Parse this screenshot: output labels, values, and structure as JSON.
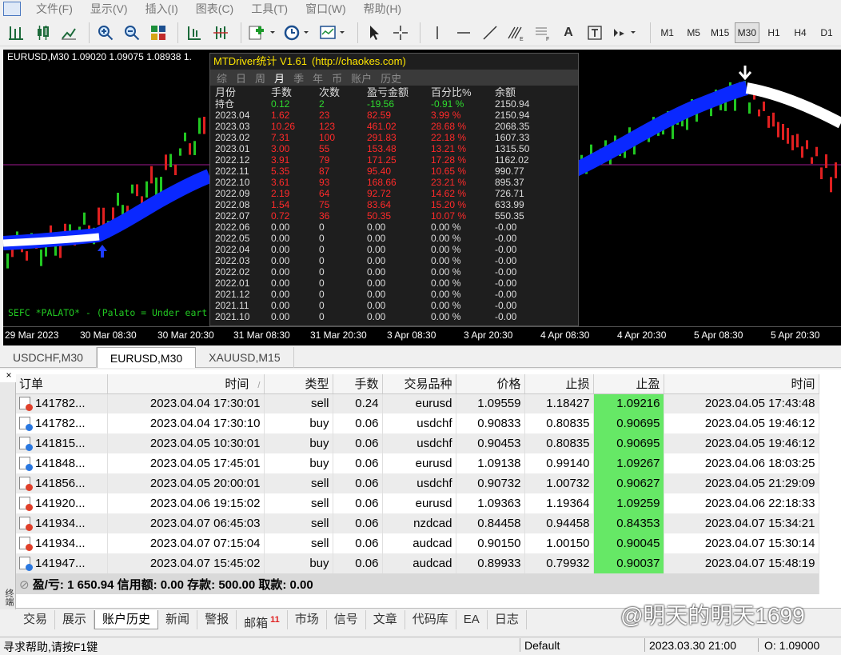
{
  "menu": [
    "文件(F)",
    "显示(V)",
    "插入(I)",
    "图表(C)",
    "工具(T)",
    "窗口(W)",
    "帮助(H)"
  ],
  "toolbar": {
    "icons": [
      "bar-chart-icon",
      "candle-chart-icon",
      "line-chart-icon",
      "zoom-in-icon",
      "zoom-out-icon",
      "tile-windows-icon",
      "chart-shift-icon",
      "autoscroll-icon",
      "indicators-icon",
      "periods-icon",
      "templates-icon",
      "cursor-icon",
      "crosshair-icon",
      "vertical-line-icon",
      "horizontal-line-icon",
      "trend-line-icon",
      "fibonacci-icon",
      "text-icon",
      "text-label-icon",
      "arrows-icon"
    ],
    "text_icon": "A",
    "timeframes": [
      "M1",
      "M5",
      "M15",
      "M30",
      "H1",
      "H4",
      "D1"
    ],
    "active_timeframe": "M30"
  },
  "chart": {
    "symbol_line": "EURUSD,M30  1.09020 1.09075 1.08938 1.",
    "indicator_label": "SEFC *PALATO* - (Palato = Under eart",
    "time_labels": [
      "29 Mar 2023",
      "30 Mar 08:30",
      "30 Mar 20:30",
      "31 Mar 08:30",
      "31 Mar 20:30",
      "3 Apr 08:30",
      "3 Apr 20:30",
      "4 Apr 08:30",
      "4 Apr 20:30",
      "5 Apr 08:30",
      "5 Apr 20:30"
    ],
    "colors": {
      "background": "#000000",
      "ma_line": "#0a28ff",
      "ma_highlight": "#ffffff",
      "bull": "#22c822",
      "bear": "#e02020"
    }
  },
  "panel": {
    "title": "MTDriver统计 V1.61",
    "url": "(http://chaokes.com)",
    "tabs": [
      "综",
      "日",
      "周",
      "月",
      "季",
      "年",
      "币",
      "账户",
      "历史"
    ],
    "active_tab": "月",
    "headers": [
      "月份",
      "手数",
      "次数",
      "盈亏金额",
      "百分比%",
      "余额"
    ],
    "rows": [
      {
        "c": [
          "持仓",
          "0.12",
          "2",
          "-19.56",
          "-0.91 %",
          "2150.94"
        ],
        "color": "green"
      },
      {
        "c": [
          "2023.04",
          "1.62",
          "23",
          "82.59",
          "3.99 %",
          "2150.94"
        ],
        "color": "red"
      },
      {
        "c": [
          "2023.03",
          "10.26",
          "123",
          "461.02",
          "28.68 %",
          "2068.35"
        ],
        "color": "red"
      },
      {
        "c": [
          "2023.02",
          "7.31",
          "100",
          "291.83",
          "22.18 %",
          "1607.33"
        ],
        "color": "red"
      },
      {
        "c": [
          "2023.01",
          "3.00",
          "55",
          "153.48",
          "13.21 %",
          "1315.50"
        ],
        "color": "red"
      },
      {
        "c": [
          "2022.12",
          "3.91",
          "79",
          "171.25",
          "17.28 %",
          "1162.02"
        ],
        "color": "red"
      },
      {
        "c": [
          "2022.11",
          "5.35",
          "87",
          "95.40",
          "10.65 %",
          "990.77"
        ],
        "color": "red"
      },
      {
        "c": [
          "2022.10",
          "3.61",
          "93",
          "168.66",
          "23.21 %",
          "895.37"
        ],
        "color": "red"
      },
      {
        "c": [
          "2022.09",
          "2.19",
          "64",
          "92.72",
          "14.62 %",
          "726.71"
        ],
        "color": "red"
      },
      {
        "c": [
          "2022.08",
          "1.54",
          "75",
          "83.64",
          "15.20 %",
          "633.99"
        ],
        "color": "red"
      },
      {
        "c": [
          "2022.07",
          "0.72",
          "36",
          "50.35",
          "10.07 %",
          "550.35"
        ],
        "color": "red"
      },
      {
        "c": [
          "2022.06",
          "0.00",
          "0",
          "0.00",
          "0.00 %",
          "-0.00"
        ],
        "color": "white"
      },
      {
        "c": [
          "2022.05",
          "0.00",
          "0",
          "0.00",
          "0.00 %",
          "-0.00"
        ],
        "color": "white"
      },
      {
        "c": [
          "2022.04",
          "0.00",
          "0",
          "0.00",
          "0.00 %",
          "-0.00"
        ],
        "color": "white"
      },
      {
        "c": [
          "2022.03",
          "0.00",
          "0",
          "0.00",
          "0.00 %",
          "-0.00"
        ],
        "color": "white"
      },
      {
        "c": [
          "2022.02",
          "0.00",
          "0",
          "0.00",
          "0.00 %",
          "-0.00"
        ],
        "color": "white"
      },
      {
        "c": [
          "2022.01",
          "0.00",
          "0",
          "0.00",
          "0.00 %",
          "-0.00"
        ],
        "color": "white"
      },
      {
        "c": [
          "2021.12",
          "0.00",
          "0",
          "0.00",
          "0.00 %",
          "-0.00"
        ],
        "color": "white"
      },
      {
        "c": [
          "2021.11",
          "0.00",
          "0",
          "0.00",
          "0.00 %",
          "-0.00"
        ],
        "color": "white"
      },
      {
        "c": [
          "2021.10",
          "0.00",
          "0",
          "0.00",
          "0.00 %",
          "-0.00"
        ],
        "color": "white"
      }
    ]
  },
  "chart_tabs": [
    "USDCHF,M30",
    "EURUSD,M30",
    "XAUUSD,M15"
  ],
  "active_chart_tab": "EURUSD,M30",
  "terminal": {
    "close": "×",
    "side_label": "终端",
    "columns": [
      "订单",
      "时间",
      "类型",
      "手数",
      "交易品种",
      "价格",
      "止损",
      "止盈",
      "时间"
    ],
    "sort_mark": "/",
    "rows": [
      {
        "order": "141782...",
        "open_time": "2023.04.04 17:30:01",
        "type": "sell",
        "lots": "0.24",
        "symbol": "eurusd",
        "price": "1.09559",
        "sl": "1.18427",
        "tp": "1.09216",
        "close_time": "2023.04.05 17:43:48"
      },
      {
        "order": "141782...",
        "open_time": "2023.04.04 17:30:10",
        "type": "buy",
        "lots": "0.06",
        "symbol": "usdchf",
        "price": "0.90833",
        "sl": "0.80835",
        "tp": "0.90695",
        "close_time": "2023.04.05 19:46:12"
      },
      {
        "order": "141815...",
        "open_time": "2023.04.05 10:30:01",
        "type": "buy",
        "lots": "0.06",
        "symbol": "usdchf",
        "price": "0.90453",
        "sl": "0.80835",
        "tp": "0.90695",
        "close_time": "2023.04.05 19:46:12"
      },
      {
        "order": "141848...",
        "open_time": "2023.04.05 17:45:01",
        "type": "buy",
        "lots": "0.06",
        "symbol": "eurusd",
        "price": "1.09138",
        "sl": "0.99140",
        "tp": "1.09267",
        "close_time": "2023.04.06 18:03:25"
      },
      {
        "order": "141856...",
        "open_time": "2023.04.05 20:00:01",
        "type": "sell",
        "lots": "0.06",
        "symbol": "usdchf",
        "price": "0.90732",
        "sl": "1.00732",
        "tp": "0.90627",
        "close_time": "2023.04.05 21:29:09"
      },
      {
        "order": "141920...",
        "open_time": "2023.04.06 19:15:02",
        "type": "sell",
        "lots": "0.06",
        "symbol": "eurusd",
        "price": "1.09363",
        "sl": "1.19364",
        "tp": "1.09259",
        "close_time": "2023.04.06 22:18:33"
      },
      {
        "order": "141934...",
        "open_time": "2023.04.07 06:45:03",
        "type": "sell",
        "lots": "0.06",
        "symbol": "nzdcad",
        "price": "0.84458",
        "sl": "0.94458",
        "tp": "0.84353",
        "close_time": "2023.04.07 15:34:21"
      },
      {
        "order": "141934...",
        "open_time": "2023.04.07 07:15:04",
        "type": "sell",
        "lots": "0.06",
        "symbol": "audcad",
        "price": "0.90150",
        "sl": "1.00150",
        "tp": "0.90045",
        "close_time": "2023.04.07 15:30:14"
      },
      {
        "order": "141947...",
        "open_time": "2023.04.07 15:45:02",
        "type": "buy",
        "lots": "0.06",
        "symbol": "audcad",
        "price": "0.89933",
        "sl": "0.79932",
        "tp": "0.90037",
        "close_time": "2023.04.07 15:48:19"
      }
    ],
    "summary": "盈/亏: 1 650.94  信用额: 0.00  存款: 500.00  取款: 0.00",
    "tp_color": "#66e866"
  },
  "bottom_tabs": [
    {
      "label": "交易"
    },
    {
      "label": "展示"
    },
    {
      "label": "账户历史"
    },
    {
      "label": "新闻"
    },
    {
      "label": "警报"
    },
    {
      "label": "邮箱",
      "badge": "11"
    },
    {
      "label": "市场"
    },
    {
      "label": "信号"
    },
    {
      "label": "文章"
    },
    {
      "label": "代码库"
    },
    {
      "label": "EA"
    },
    {
      "label": "日志"
    }
  ],
  "active_bottom_tab": "账户历史",
  "watermark": "@明天的明天1699",
  "status": {
    "help": "寻求帮助,请按F1键",
    "profile": "Default",
    "datetime": "2023.03.30 21:00",
    "open": "O: 1.09000"
  }
}
